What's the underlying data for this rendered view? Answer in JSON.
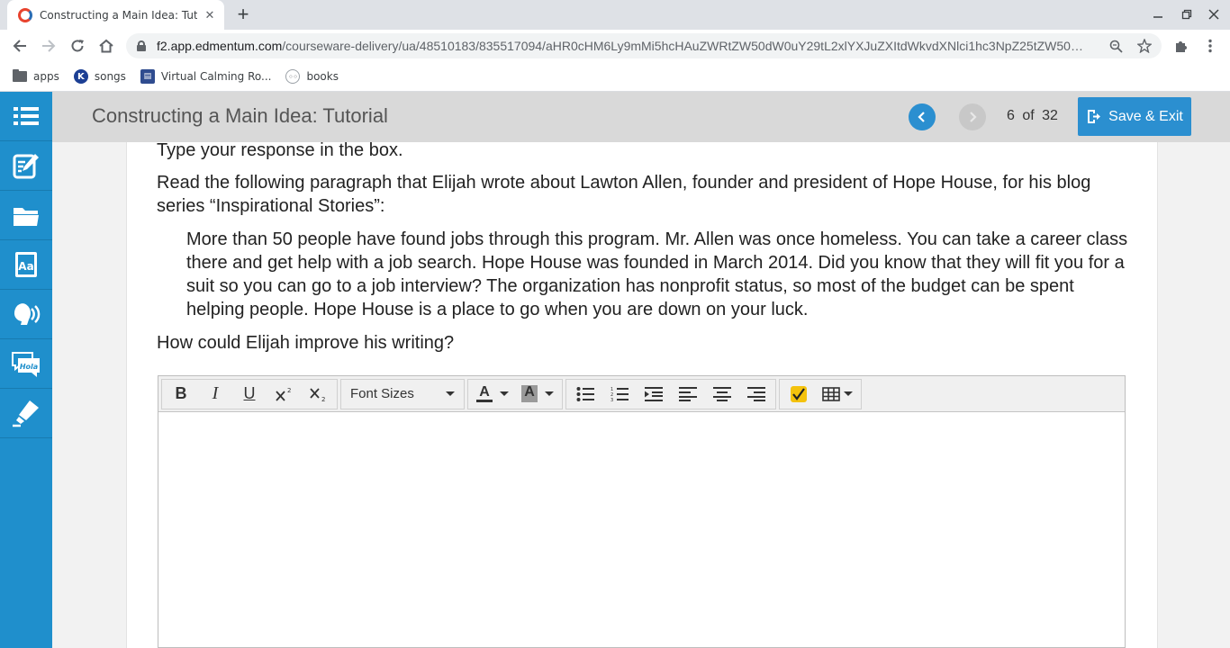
{
  "browser": {
    "tab_title": "Constructing a Main Idea: Tutorial",
    "tab_close": "✕",
    "new_tab": "+",
    "url_host": "f2.app.edmentum.com",
    "url_path": "/courseware-delivery/ua/48510183/835517094/aHR0cHM6Ly9mMi5hcHAuZWRtZW50dW0uY29tL2xlYXJuZXItdWkvdXNlci1hc3NpZ25tZW50…",
    "bookmarks": [
      {
        "label": "apps",
        "icon": "folder-icon"
      },
      {
        "label": "songs",
        "icon": "k-logo-icon"
      },
      {
        "label": "Virtual Calming Ro...",
        "icon": "calendar-icon"
      },
      {
        "label": "books",
        "icon": "books-icon"
      }
    ]
  },
  "header": {
    "title": "Constructing a Main Idea: Tutorial",
    "page_current": "6",
    "page_of": "of",
    "page_total": "32",
    "save_exit_label": "Save & Exit"
  },
  "content": {
    "instruction": "Type your response in the box.",
    "prompt": "Read the following paragraph that Elijah wrote about Lawton Allen, founder and president of Hope House, for his blog series “Inspirational Stories”:",
    "quote": "More than 50 people have found jobs through this program. Mr. Allen was once homeless. You can take a career class there and get help with a job search. Hope House was founded in March 2014. Did you know that they will fit you for a suit so you can go to a job interview? The organization has nonprofit status, so most of the budget can be spent helping people. Hope House is a place to go when you are down on your luck.",
    "question": "How could Elijah improve his writing?"
  },
  "editor": {
    "font_sizes_label": "Font Sizes",
    "bold": "B",
    "italic": "I",
    "underline": "U",
    "text_color_glyph": "A",
    "bg_color_glyph": "A"
  },
  "colors": {
    "rail": "#1f8fcc",
    "accent": "#2b8fd0"
  }
}
